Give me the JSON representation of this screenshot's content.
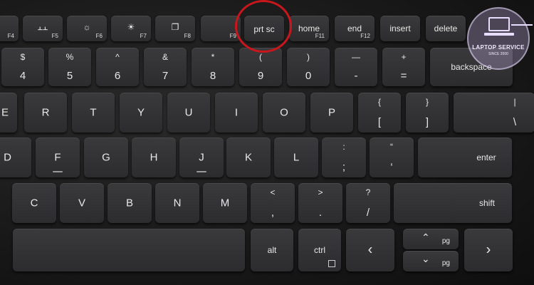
{
  "image": {
    "subject": "laptop-keyboard",
    "highlight_color": "#c8161d",
    "watermark": {
      "title": "LAPTOP SERVICE",
      "subtitle": "SINCE 2000"
    }
  },
  "rows": {
    "function": [
      {
        "id": "f4",
        "fn": "F4",
        "icon": ""
      },
      {
        "id": "f5",
        "fn": "F5",
        "icon": "keyboard-backlight-icon"
      },
      {
        "id": "f6",
        "fn": "F6",
        "icon": "brightness-down-icon"
      },
      {
        "id": "f7",
        "fn": "F7",
        "icon": "brightness-up-icon"
      },
      {
        "id": "f8",
        "fn": "F8",
        "icon": "display-switch-icon"
      },
      {
        "id": "f9",
        "fn": "F9",
        "icon": ""
      },
      {
        "id": "prtsc",
        "label": "prt sc",
        "fn": ""
      },
      {
        "id": "home",
        "label": "home",
        "fn": "F11"
      },
      {
        "id": "end",
        "label": "end",
        "fn": "F12"
      },
      {
        "id": "insert",
        "label": "insert",
        "fn": ""
      },
      {
        "id": "delete",
        "label": "delete",
        "fn": ""
      }
    ],
    "number": [
      {
        "top": "$",
        "bottom": "4"
      },
      {
        "top": "%",
        "bottom": "5"
      },
      {
        "top": "^",
        "bottom": "6"
      },
      {
        "top": "&",
        "bottom": "7"
      },
      {
        "top": "*",
        "bottom": "8"
      },
      {
        "top": "(",
        "bottom": "9"
      },
      {
        "top": ")",
        "bottom": "0"
      },
      {
        "top": "—",
        "bottom": "-"
      },
      {
        "top": "+",
        "bottom": "="
      },
      {
        "label": "backspace"
      }
    ],
    "top_letters": [
      {
        "label": "E"
      },
      {
        "label": "R"
      },
      {
        "label": "T"
      },
      {
        "label": "Y"
      },
      {
        "label": "U"
      },
      {
        "label": "I"
      },
      {
        "label": "O"
      },
      {
        "label": "P"
      },
      {
        "top": "{",
        "bottom": "["
      },
      {
        "top": "}",
        "bottom": "]"
      },
      {
        "top": "|",
        "bottom": "\\"
      }
    ],
    "home_letters": [
      {
        "label": "D"
      },
      {
        "label": "F"
      },
      {
        "label": "G"
      },
      {
        "label": "H"
      },
      {
        "label": "J"
      },
      {
        "label": "K"
      },
      {
        "label": "L"
      },
      {
        "top": ":",
        "bottom": ";"
      },
      {
        "top": "“",
        "bottom": "‘"
      },
      {
        "label": "enter"
      }
    ],
    "bottom_letters": [
      {
        "label": "C"
      },
      {
        "label": "V"
      },
      {
        "label": "B"
      },
      {
        "label": "N"
      },
      {
        "label": "M"
      },
      {
        "top": "<",
        "bottom": ","
      },
      {
        "top": ">",
        "bottom": "."
      },
      {
        "top": "?",
        "bottom": "/"
      },
      {
        "label": "shift"
      }
    ],
    "space_row": [
      {
        "label": "alt"
      },
      {
        "label": "ctrl"
      },
      {
        "label": "‹"
      },
      {
        "label": "›"
      },
      {
        "label": "pg"
      },
      {
        "label": "pg"
      }
    ]
  }
}
